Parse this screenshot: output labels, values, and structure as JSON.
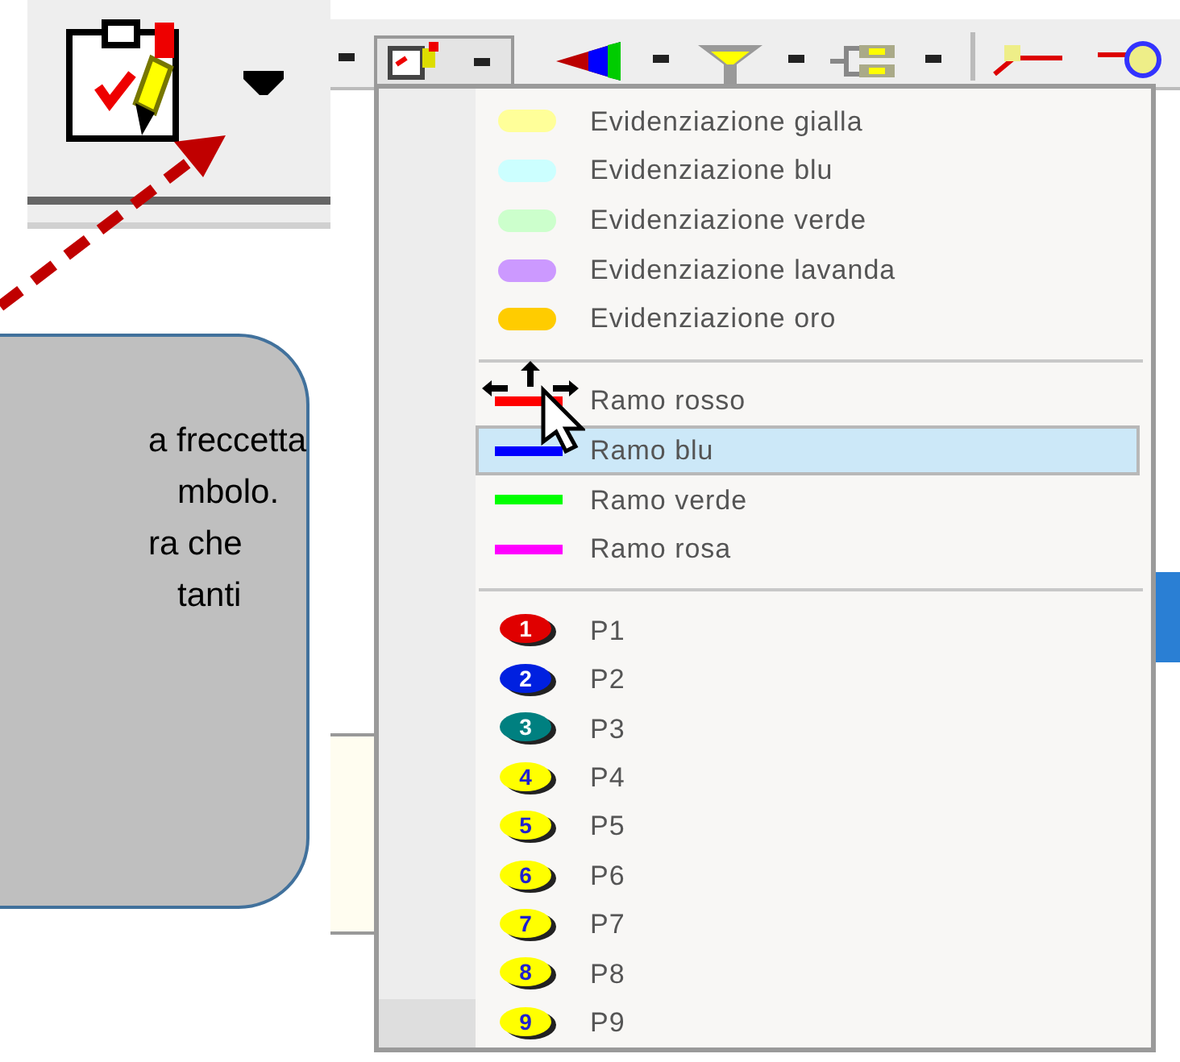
{
  "callout": {
    "lines": [
      "a freccetta",
      "mbolo.",
      "ra che",
      "tanti"
    ]
  },
  "menu": {
    "sections": [
      {
        "kind": "highlight",
        "items": [
          {
            "label": "Evidenziazione gialla",
            "color": "#ffff99",
            "selected": false
          },
          {
            "label": "Evidenziazione blu",
            "color": "#ccffff",
            "selected": false
          },
          {
            "label": "Evidenziazione verde",
            "color": "#ccffcc",
            "selected": false
          },
          {
            "label": "Evidenziazione lavanda",
            "color": "#cc99ff",
            "selected": false
          },
          {
            "label": "Evidenziazione oro",
            "color": "#ffcc00",
            "selected": false
          }
        ]
      },
      {
        "kind": "branch",
        "items": [
          {
            "label": "Ramo rosso",
            "color": "#ff0000",
            "selected": false
          },
          {
            "label": "Ramo blu",
            "color": "#0000ff",
            "selected": true
          },
          {
            "label": "Ramo verde",
            "color": "#00ff00",
            "selected": false
          },
          {
            "label": "Ramo rosa",
            "color": "#ff00ff",
            "selected": false
          }
        ]
      },
      {
        "kind": "point",
        "items": [
          {
            "label": "P1",
            "badge": "1",
            "color": "#e00000",
            "selected": false
          },
          {
            "label": "P2",
            "badge": "2",
            "color": "#0020e0",
            "selected": false
          },
          {
            "label": "P3",
            "badge": "3",
            "color": "#008080",
            "selected": false
          },
          {
            "label": "P4",
            "badge": "4",
            "color": "#ffff00",
            "selected": false
          },
          {
            "label": "P5",
            "badge": "5",
            "color": "#ffff00",
            "selected": false
          },
          {
            "label": "P6",
            "badge": "6",
            "color": "#ffff00",
            "selected": false
          },
          {
            "label": "P7",
            "badge": "7",
            "color": "#ffff00",
            "selected": false
          },
          {
            "label": "P8",
            "badge": "8",
            "color": "#ffff00",
            "selected": false
          },
          {
            "label": "P9",
            "badge": "9",
            "color": "#ffff00",
            "selected": false
          }
        ]
      }
    ]
  }
}
